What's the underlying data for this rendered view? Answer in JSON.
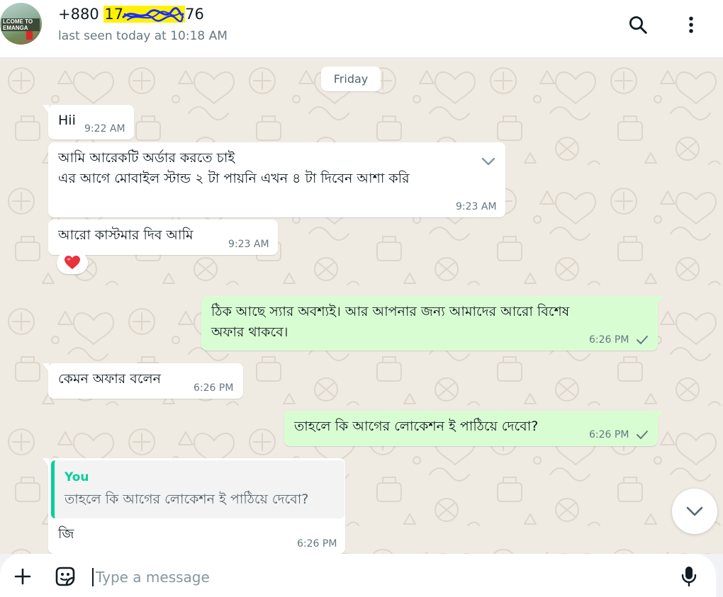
{
  "header": {
    "contact_prefix": "+880 ",
    "contact_visible_start": "17",
    "contact_visible_end": "76",
    "status": "last seen today at 10:18 AM",
    "avatar_sign_line1": "LCOME TO",
    "avatar_sign_line2": "EMANGA",
    "search_icon": "search-icon",
    "menu_icon": "more-vertical-icon"
  },
  "chat": {
    "date_label": "Friday",
    "messages": [
      {
        "direction": "in",
        "text": "Hii",
        "time": "9:22 AM"
      },
      {
        "direction": "in",
        "lines": [
          "আমি আরেকটি অর্ডার করতে চাই",
          "এর আগে মোবাইল স্টান্ড ২ টা পায়নি এখন ৪ টা দিবেন আশা করি"
        ],
        "time": "9:23 AM"
      },
      {
        "direction": "in",
        "text": "আরো কাস্টমার দিব আমি",
        "time": "9:23 AM",
        "reaction": "❤️"
      },
      {
        "direction": "out",
        "lines": [
          "ঠিক আছে স্যার অবশ্যই। আর আপনার জন্য আমাদের আরো বিশেষ",
          "অফার থাকবে।"
        ],
        "time": "6:26 PM",
        "status": "sent"
      },
      {
        "direction": "in",
        "text": "কেমন অফার বলেন",
        "time": "6:26 PM"
      },
      {
        "direction": "out",
        "text": "তাহলে কি আগের লোকেশন ই পাঠিয়ে দেবো?",
        "time": "6:26 PM",
        "status": "sent"
      },
      {
        "direction": "in",
        "quote_author": "You",
        "quote_text": "তাহলে কি আগের লোকেশন ই পাঠিয়ে দেবো?",
        "text": "জি",
        "time": "6:26 PM"
      }
    ]
  },
  "composer": {
    "placeholder": "Type a message",
    "value": "",
    "attach_icon": "plus-icon",
    "sticker_icon": "sticker-icon",
    "mic_icon": "microphone-icon"
  },
  "colors": {
    "chat_background": "#efeae2",
    "incoming_bubble": "#ffffff",
    "outgoing_bubble": "#d9fdd3",
    "quote_accent": "#06cf9c",
    "highlight": "#fff200",
    "scribble": "#1a2cff",
    "secondary_text": "#667781"
  }
}
